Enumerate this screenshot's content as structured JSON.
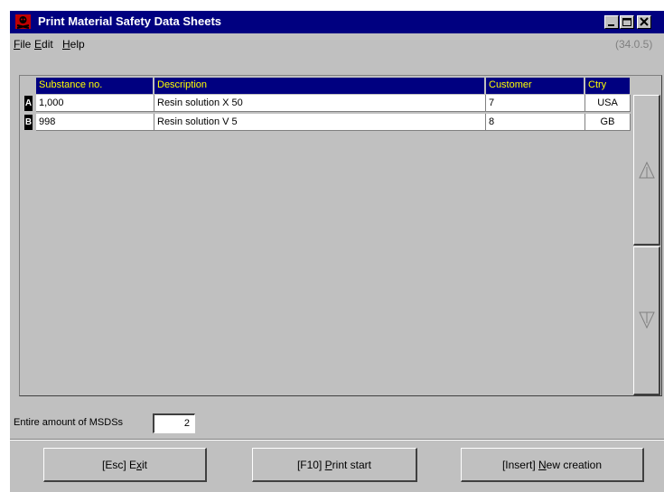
{
  "window": {
    "title": "Print Material Safety Data Sheets",
    "version": "(34.0.5)"
  },
  "menu": {
    "file": {
      "first": "F",
      "rest": "ile"
    },
    "edit": {
      "first": "E",
      "rest": "dit"
    },
    "help": {
      "first": "H",
      "rest": "elp"
    }
  },
  "table": {
    "columns": [
      "Substance no.",
      "Description",
      "Customer",
      "Ctry"
    ],
    "rows": [
      {
        "marker": "A",
        "substance_no": "1,000",
        "description": "Resin solution  X 50",
        "customer": "7",
        "country": "USA"
      },
      {
        "marker": "B",
        "substance_no": "998",
        "description": "Resin solution  V 5",
        "customer": "8",
        "country": "GB"
      }
    ]
  },
  "summary": {
    "label": "Entire amount of MSDSs",
    "count": "2"
  },
  "buttons": {
    "exit": {
      "pre": "[Esc] E",
      "u": "x",
      "post": "it"
    },
    "print": {
      "pre": "[F10] ",
      "u": "P",
      "post": "rint start"
    },
    "new": {
      "pre": "[Insert] ",
      "u": "N",
      "post": "ew creation"
    }
  },
  "icons": {
    "app": "hazard-icon",
    "minimize": "minimize-icon",
    "maximize": "maximize-icon",
    "close": "close-icon",
    "scroll_up": "arrow-up-icon",
    "scroll_down": "arrow-down-icon"
  },
  "colors": {
    "titlebar": "#000080",
    "header_bg": "#000080",
    "header_text": "#ffff00",
    "face": "#c0c0c0"
  }
}
